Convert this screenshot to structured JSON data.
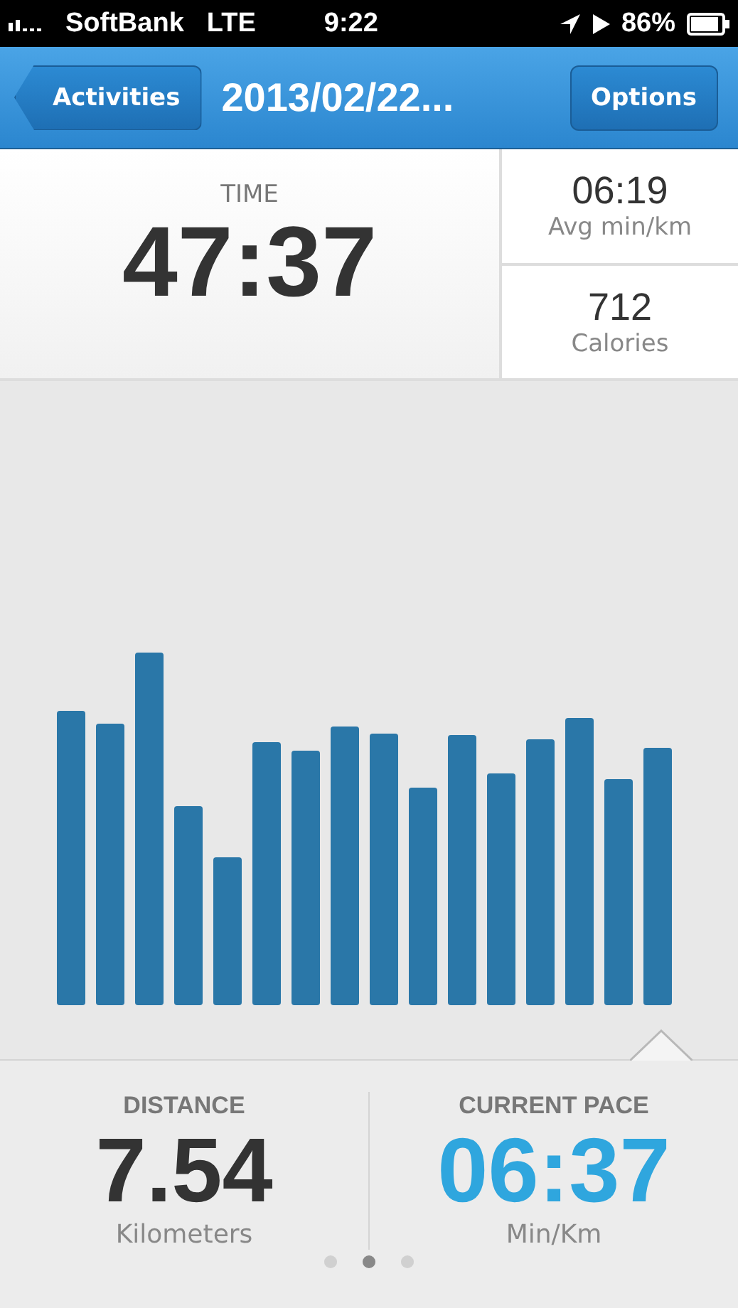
{
  "status_bar": {
    "carrier": "SoftBank",
    "network": "LTE",
    "time": "9:22",
    "battery": "86%"
  },
  "nav_bar": {
    "back_button": "Activities",
    "title": "2013/02/22...",
    "options_button": "Options"
  },
  "summary": {
    "main": {
      "label": "TIME",
      "value": "47:37"
    },
    "side": [
      {
        "value": "06:19",
        "label": "Avg min/km"
      },
      {
        "value": "712",
        "label": "Calories"
      }
    ]
  },
  "chart": {
    "kind": "bars"
  },
  "bottom_panel": {
    "metrics": [
      {
        "label": "DISTANCE",
        "value": "7.54",
        "unit": "Kilometers",
        "highlight": false
      },
      {
        "label": "CURRENT PACE",
        "value": "06:37",
        "unit": "Min/Km",
        "highlight": true
      }
    ],
    "page_indicator": [
      {
        "selected": false
      },
      {
        "selected": true
      },
      {
        "selected": false
      }
    ]
  }
}
